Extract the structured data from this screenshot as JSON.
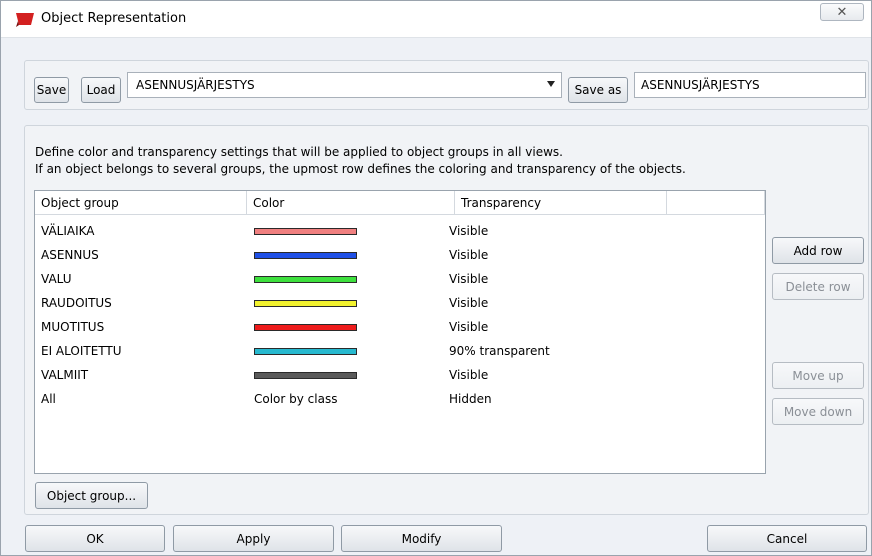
{
  "window": {
    "title": "Object Representation",
    "close_glyph": "✕",
    "close_icon": "close-icon",
    "app_icon": "tekla-icon"
  },
  "toolbar": {
    "save_label": "Save",
    "load_label": "Load",
    "selected_setting": "ASENNUSJÄRJESTYS",
    "save_as_label": "Save as",
    "save_as_name": "ASENNUSJÄRJESTYS"
  },
  "description": {
    "line1": "Define color and transparency settings that will be applied to object groups in all views.",
    "line2": "If an object belongs to several groups, the upmost row defines the coloring and transparency of the objects."
  },
  "table": {
    "headers": [
      "Object group",
      "Color",
      "Transparency"
    ],
    "rows": [
      {
        "group": "VÄLIAIKA",
        "color": "#f08080",
        "color_text": "",
        "transparency": "Visible"
      },
      {
        "group": "ASENNUS",
        "color": "#1f50e6",
        "color_text": "",
        "transparency": "Visible"
      },
      {
        "group": "VALU",
        "color": "#3ee03e",
        "color_text": "",
        "transparency": "Visible"
      },
      {
        "group": "RAUDOITUS",
        "color": "#f2f22e",
        "color_text": "",
        "transparency": "Visible"
      },
      {
        "group": "MUOTITUS",
        "color": "#ee1b1b",
        "color_text": "",
        "transparency": "Visible"
      },
      {
        "group": "EI ALOITETTU",
        "color": "#27b9cf",
        "color_text": "",
        "transparency": "90% transparent"
      },
      {
        "group": "VALMIIT",
        "color": "#5a5a5a",
        "color_text": "",
        "transparency": "Visible"
      },
      {
        "group": "All",
        "color": "",
        "color_text": "Color by class",
        "transparency": "Hidden"
      }
    ]
  },
  "side_buttons": {
    "add_row": "Add row",
    "delete_row": "Delete row",
    "move_up": "Move up",
    "move_down": "Move down"
  },
  "object_group_button": "Object group...",
  "footer": {
    "ok": "OK",
    "apply": "Apply",
    "modify": "Modify",
    "cancel": "Cancel"
  }
}
